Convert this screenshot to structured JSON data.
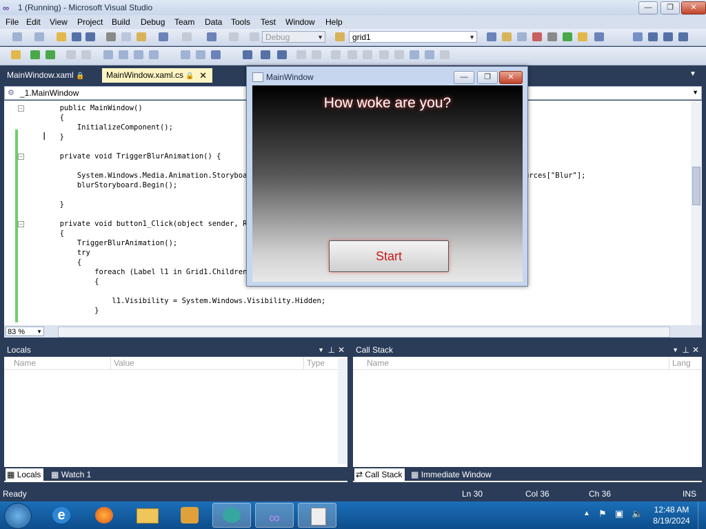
{
  "window": {
    "title": "1 (Running) - Microsoft Visual Studio",
    "min": "—",
    "max": "❐",
    "close": "✕"
  },
  "menu": [
    "File",
    "Edit",
    "View",
    "Project",
    "Build",
    "Debug",
    "Team",
    "Data",
    "Tools",
    "Test",
    "Window",
    "Help"
  ],
  "toolbar": {
    "config_combo": "Debug",
    "find_combo": "grid1"
  },
  "doc_tabs": [
    {
      "label": "MainWindow.xaml",
      "active": false
    },
    {
      "label": "MainWindow.xaml.cs",
      "active": true
    }
  ],
  "nav": {
    "class_combo": "_1.MainWindow"
  },
  "code": [
    "        public MainWindow()",
    "        {",
    "            InitializeComponent();",
    "        }",
    "",
    "        private void TriggerBlurAnimation() {",
    "",
    "            System.Windows.Media.Animation.Storyboard b",
    "            blurStoryboard.Begin();",
    "",
    "        }",
    "",
    "        private void button1_Click(object sender, Rout",
    "        {",
    "            TriggerBlurAnimation();",
    "            try",
    "            {",
    "                foreach (Label l1 in Grid1.Children)",
    "                {",
    "",
    "                    l1.Visibility = System.Windows.Visibility.Hidden;",
    "                }"
  ],
  "code_right_fragment": "urces[\"Blur\"];",
  "editor": {
    "zoom": "83 %"
  },
  "locals": {
    "title": "Locals",
    "columns": [
      "Name",
      "Value",
      "Type"
    ]
  },
  "callstack": {
    "title": "Call Stack",
    "columns": [
      "Name",
      "Lang"
    ]
  },
  "left_tabs": [
    "Locals",
    "Watch 1"
  ],
  "right_tabs": [
    "Call Stack",
    "Immediate Window"
  ],
  "status": {
    "ready": "Ready",
    "ln": "Ln 30",
    "col": "Col 36",
    "ch": "Ch 36",
    "ins": "INS"
  },
  "app_window": {
    "title": "MainWindow",
    "question": "How woke are you?",
    "start": "Start"
  },
  "tray": {
    "time": "12:48 AM",
    "date": "8/19/2024"
  },
  "colors": {
    "vs_dark": "#2b3c59",
    "start_text": "#c81818"
  }
}
